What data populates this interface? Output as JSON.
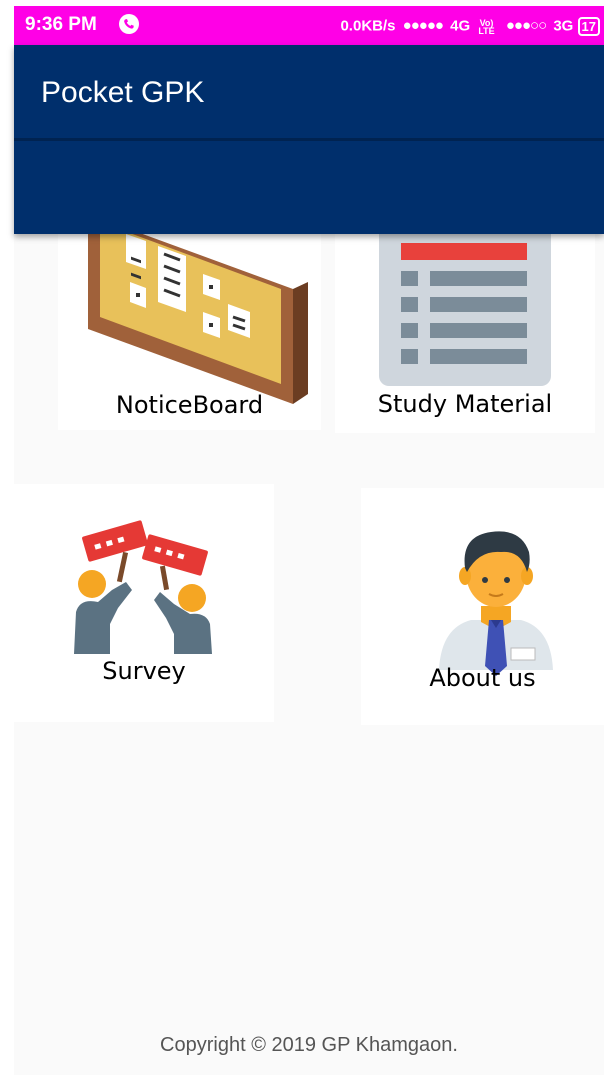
{
  "status_bar": {
    "time": "9:36 PM",
    "network_speed": "0.0KB/s",
    "signal1_type": "4G",
    "volte_line1": "Vo)",
    "volte_line2": "LTE",
    "signal2_type": "3G",
    "battery": "17",
    "icons": [
      "phone-call-icon",
      "signal-dots-icon",
      "volte-icon",
      "battery-icon"
    ]
  },
  "app_bar": {
    "title": "Pocket GPK"
  },
  "menu": [
    {
      "label": "NoticeBoard",
      "icon": "noticeboard-icon"
    },
    {
      "label": "Study Material",
      "icon": "study-material-icon"
    },
    {
      "label": "Survey",
      "icon": "survey-icon"
    },
    {
      "label": "About us",
      "icon": "about-us-icon"
    }
  ],
  "footer": {
    "copyright": "Copyright © 2019 GP Khamgaon."
  },
  "colors": {
    "status_bar_bg": "#ff00e6",
    "app_bar_bg": "#002f6c",
    "content_bg": "#fafafa",
    "card_bg": "#ffffff"
  }
}
